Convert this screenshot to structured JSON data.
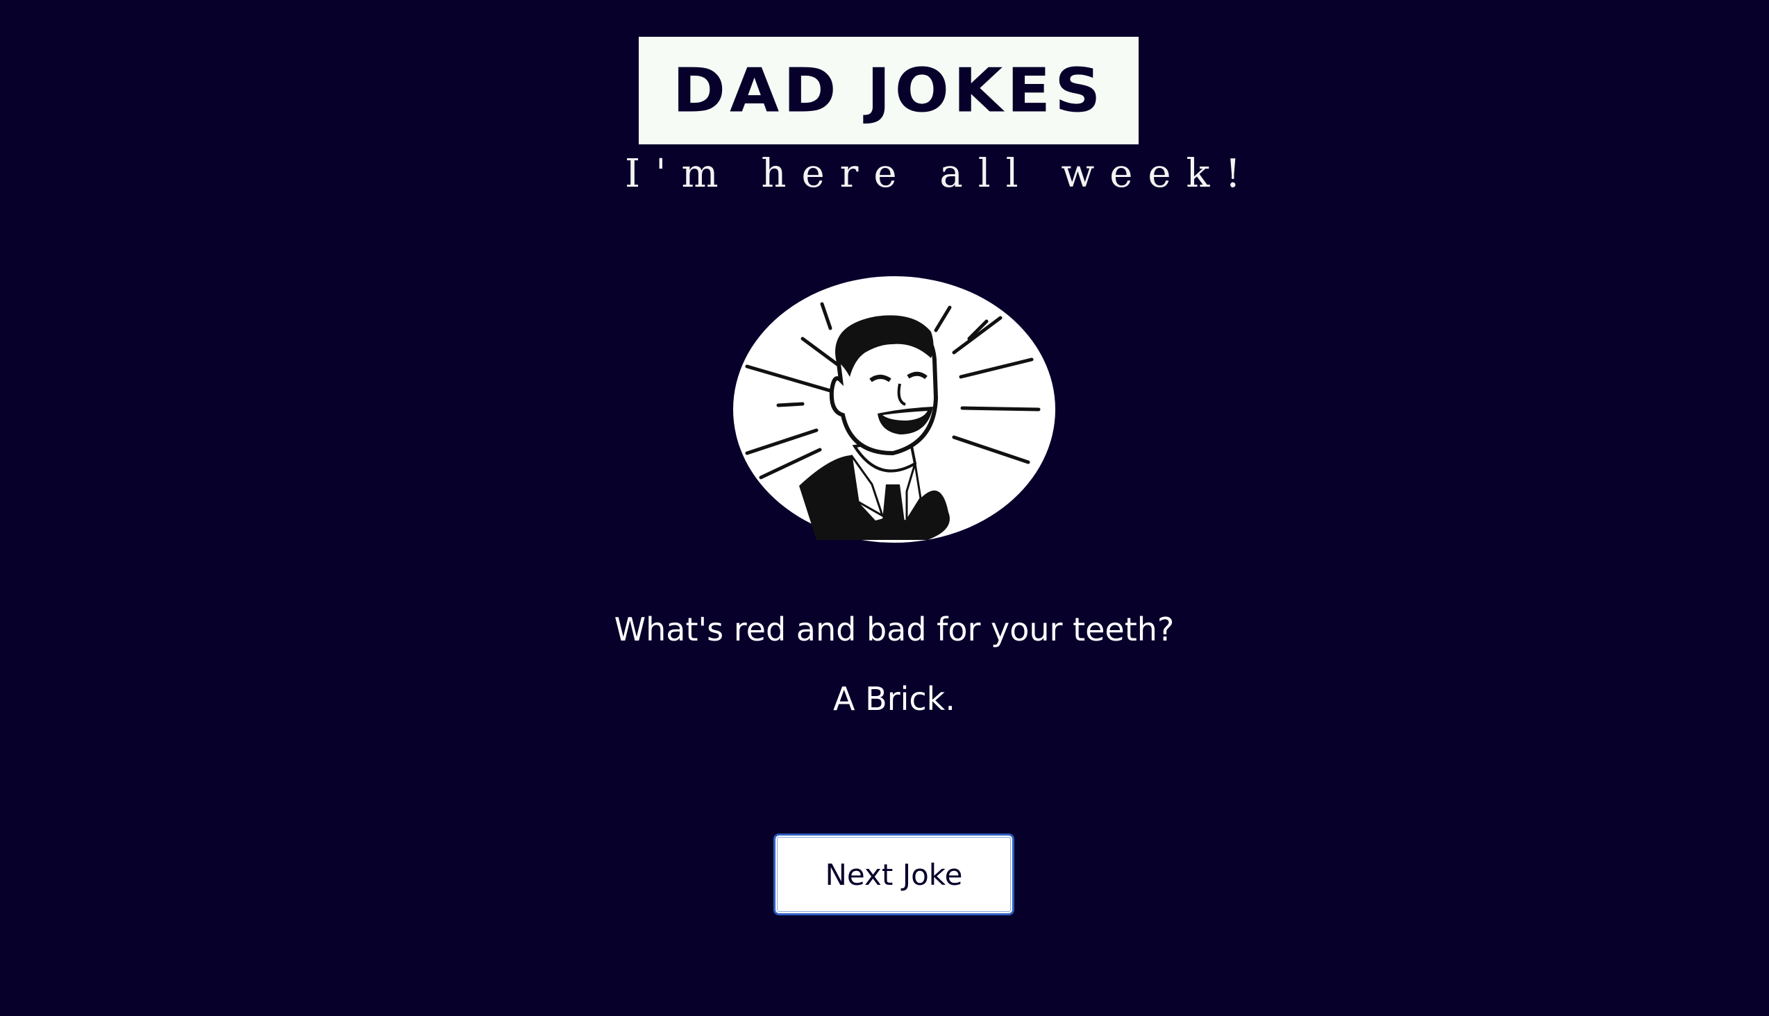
{
  "header": {
    "logo_text": "DAD JOKES",
    "tagline": "I'm here all week!"
  },
  "avatar": {
    "icon": "laughing-man-illustration"
  },
  "joke": {
    "setup": "What's red and bad for your teeth?",
    "punchline": "A Brick."
  },
  "actions": {
    "next_label": "Next Joke"
  },
  "colors": {
    "background": "#07002b",
    "logo_box": "#f6fbf5",
    "text": "#ffffff",
    "button_border": "#2f5fc0"
  }
}
